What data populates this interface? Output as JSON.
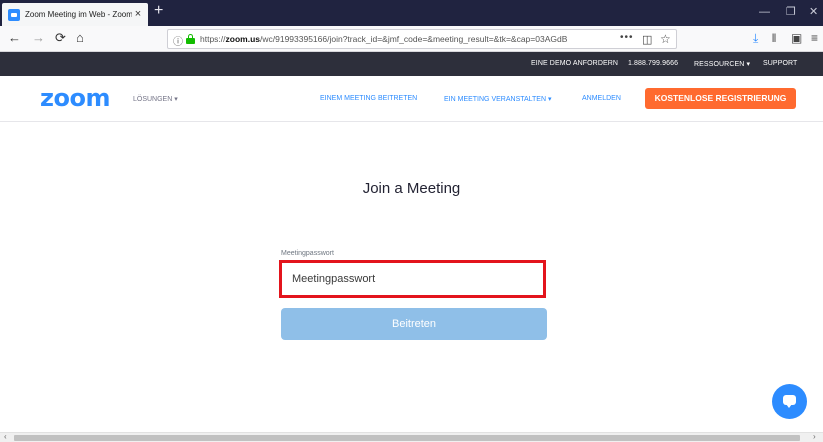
{
  "browser": {
    "tab_title": "Zoom Meeting im Web - Zoom",
    "tab_close": "×",
    "new_tab": "+",
    "url_prefix": "https://",
    "url_domain": "zoom.us",
    "url_path": "/wc/91993395166/join?track_id=&jmf_code=&meeting_result=&tk=&cap=03AGdB",
    "url_more": "•••",
    "icons": {
      "back": "←",
      "forward": "→",
      "reload": "⟳",
      "home": "⌂",
      "info": "ⓘ",
      "pocket": "◫",
      "bookmark": "☆",
      "download": "⤓",
      "library": "𝍪",
      "sidebar": "▣",
      "menu": "≡",
      "minimize": "—",
      "restore": "❐",
      "close": "✕"
    }
  },
  "topbar": {
    "demo": "EINE DEMO ANFORDERN",
    "phone": "1.888.799.9666",
    "resources": "RESSOURCEN ▾",
    "support": "SUPPORT"
  },
  "header": {
    "logo": "zoom",
    "solutions": "LÖSUNGEN ▾",
    "join": "EINEM MEETING BEITRETEN",
    "host": "EIN MEETING VERANSTALTEN ▾",
    "signin": "ANMELDEN",
    "register": "KOSTENLOSE REGISTRIERUNG"
  },
  "join_form": {
    "title": "Join a Meeting",
    "password_label": "Meetingpasswort",
    "password_placeholder": "Meetingpasswort",
    "submit": "Beitreten"
  },
  "scrollbar": {
    "left": "‹",
    "right": "›"
  },
  "colors": {
    "zoom_blue": "#2d8cff",
    "register_orange": "#ff6a2f",
    "highlight_red": "#e3141c",
    "button_disabled": "#8fbfe8",
    "topbar_dark": "#2d2f3b"
  }
}
